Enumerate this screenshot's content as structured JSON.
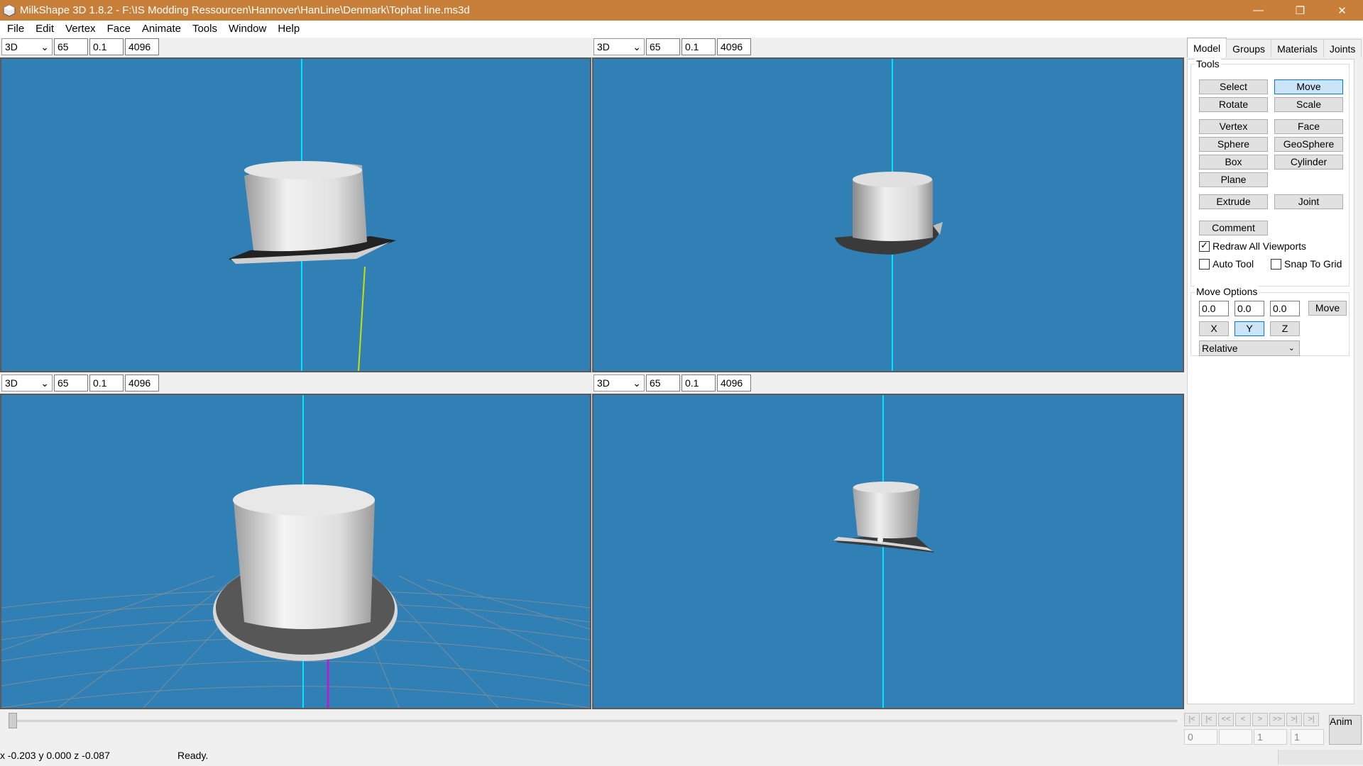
{
  "window": {
    "title": "MilkShape 3D 1.8.2 - F:\\IS Modding Ressourcen\\Hannover\\HanLine\\Denmark\\Tophat line.ms3d",
    "minimize": "—",
    "restore": "❐",
    "close": "✕"
  },
  "menu": [
    "File",
    "Edit",
    "Vertex",
    "Face",
    "Animate",
    "Tools",
    "Window",
    "Help"
  ],
  "viewports": [
    {
      "mode": "3D",
      "fov": "65",
      "near": "0.1",
      "far": "4096"
    },
    {
      "mode": "3D",
      "fov": "65",
      "near": "0.1",
      "far": "4096"
    },
    {
      "mode": "3D",
      "fov": "65",
      "near": "0.1",
      "far": "4096"
    },
    {
      "mode": "3D",
      "fov": "65",
      "near": "0.1",
      "far": "4096"
    }
  ],
  "panel": {
    "tabs": [
      "Model",
      "Groups",
      "Materials",
      "Joints"
    ],
    "active_tab": "Model",
    "tools_label": "Tools",
    "tools": {
      "select": "Select",
      "move": "Move",
      "rotate": "Rotate",
      "scale": "Scale",
      "vertex": "Vertex",
      "face": "Face",
      "sphere": "Sphere",
      "geosphere": "GeoSphere",
      "box": "Box",
      "cylinder": "Cylinder",
      "plane": "Plane",
      "extrude": "Extrude",
      "joint": "Joint",
      "comment": "Comment"
    },
    "active_tool": "Move",
    "redraw_all": {
      "label": "Redraw All Viewports",
      "checked": true
    },
    "auto_tool": {
      "label": "Auto Tool",
      "checked": false
    },
    "snap_to_grid": {
      "label": "Snap To Grid",
      "checked": false
    },
    "move_options": {
      "label": "Move Options",
      "x": "0.0",
      "y": "0.0",
      "z": "0.0",
      "move_button": "Move",
      "axes": [
        "X",
        "Y",
        "Z"
      ],
      "active_axis": "Y",
      "mode": "Relative"
    }
  },
  "timeline": {
    "buttons": [
      "|<",
      "|<",
      "<<",
      "<",
      ">",
      ">>",
      ">|",
      ">|"
    ],
    "start": "0",
    "current": "",
    "frame": "1",
    "end": "1",
    "anim_label": "Anim"
  },
  "status": {
    "coords": "x -0.203 y 0.000 z -0.087",
    "message": "Ready."
  },
  "colors": {
    "titlebar": "#c87f3a",
    "viewport_bg": "#3080b5",
    "axis_line": "#00e5ff",
    "active_button": "#cce4f7"
  }
}
